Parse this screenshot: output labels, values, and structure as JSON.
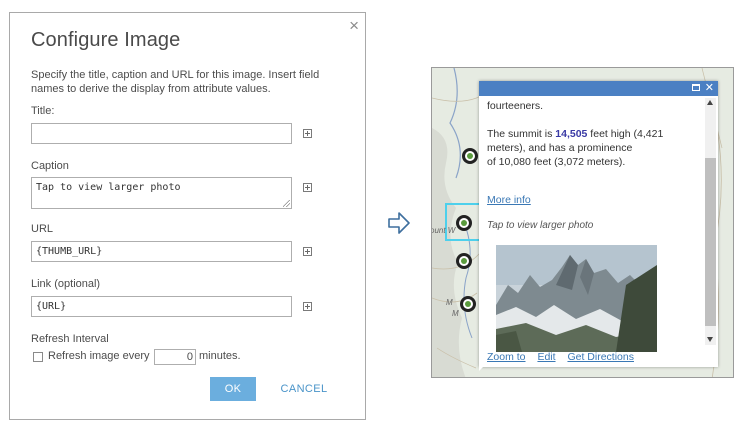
{
  "dialog": {
    "title": "Configure Image",
    "description": "Specify the title, caption and URL for this image. Insert field names to derive the display from attribute values.",
    "title_label": "Title:",
    "title_value": "",
    "caption_label": "Caption",
    "caption_value": "Tap to view larger photo",
    "url_label": "URL",
    "url_value": "{THUMB_URL}",
    "link_label": "Link (optional)",
    "link_value": "{URL}",
    "refresh_heading": "Refresh Interval",
    "refresh_label": "Refresh image every",
    "refresh_minutes": "0",
    "minutes_label": "minutes.",
    "ok_label": "OK",
    "cancel_label": "CANCEL",
    "close_glyph": "×"
  },
  "arrow_icon": "right-arrow-outline-icon",
  "popup": {
    "line1": "fourteeners.",
    "summit_prefix": "The summit is ",
    "summit_value": "14,505",
    "summit_suffix": " feet high (4,421",
    "line3": "meters), and has a prominence",
    "line4": "of 10,080 feet (3,072 meters).",
    "more_info": "More info",
    "caption": "Tap to view larger photo",
    "close_glyph": "✕",
    "footer": {
      "zoom": "Zoom to",
      "edit": "Edit",
      "directions": "Get Directions"
    }
  },
  "map_labels": {
    "label1": "ount W",
    "label2": "M",
    "label3": "M"
  },
  "colors": {
    "popup_header": "#4b80c3",
    "ok_button": "#6baede",
    "link": "#3a78b5",
    "highlight": "#4dd0ec"
  }
}
